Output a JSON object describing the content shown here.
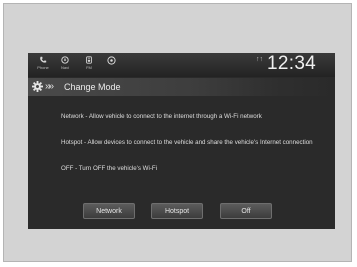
{
  "status_bar": {
    "buttons": [
      {
        "label": "Phone",
        "icon": "phone-icon"
      },
      {
        "label": "Navi",
        "icon": "navigation-icon"
      },
      {
        "label": "FM",
        "icon": "audio-icon"
      },
      {
        "label": "",
        "icon": "app-icon"
      }
    ],
    "signal": "↑↑",
    "clock": "12:34"
  },
  "title_bar": {
    "icon": "gear-icon",
    "chevrons": "»»",
    "title": "Change Mode"
  },
  "content": {
    "lines": [
      "Network - Allow vehicle to connect to the internet through a Wi-Fi network",
      "Hotspot - Allow devices to connect to the vehicle and share the vehicle's Internet connection",
      "OFF - Turn OFF the vehicle's Wi-Fi"
    ]
  },
  "buttons": {
    "network": "Network",
    "hotspot": "Hotspot",
    "off": "Off"
  },
  "colors": {
    "screen_bg": "#2a2a2a",
    "text": "#dedede",
    "frame_bg": "#d3d3d3"
  }
}
